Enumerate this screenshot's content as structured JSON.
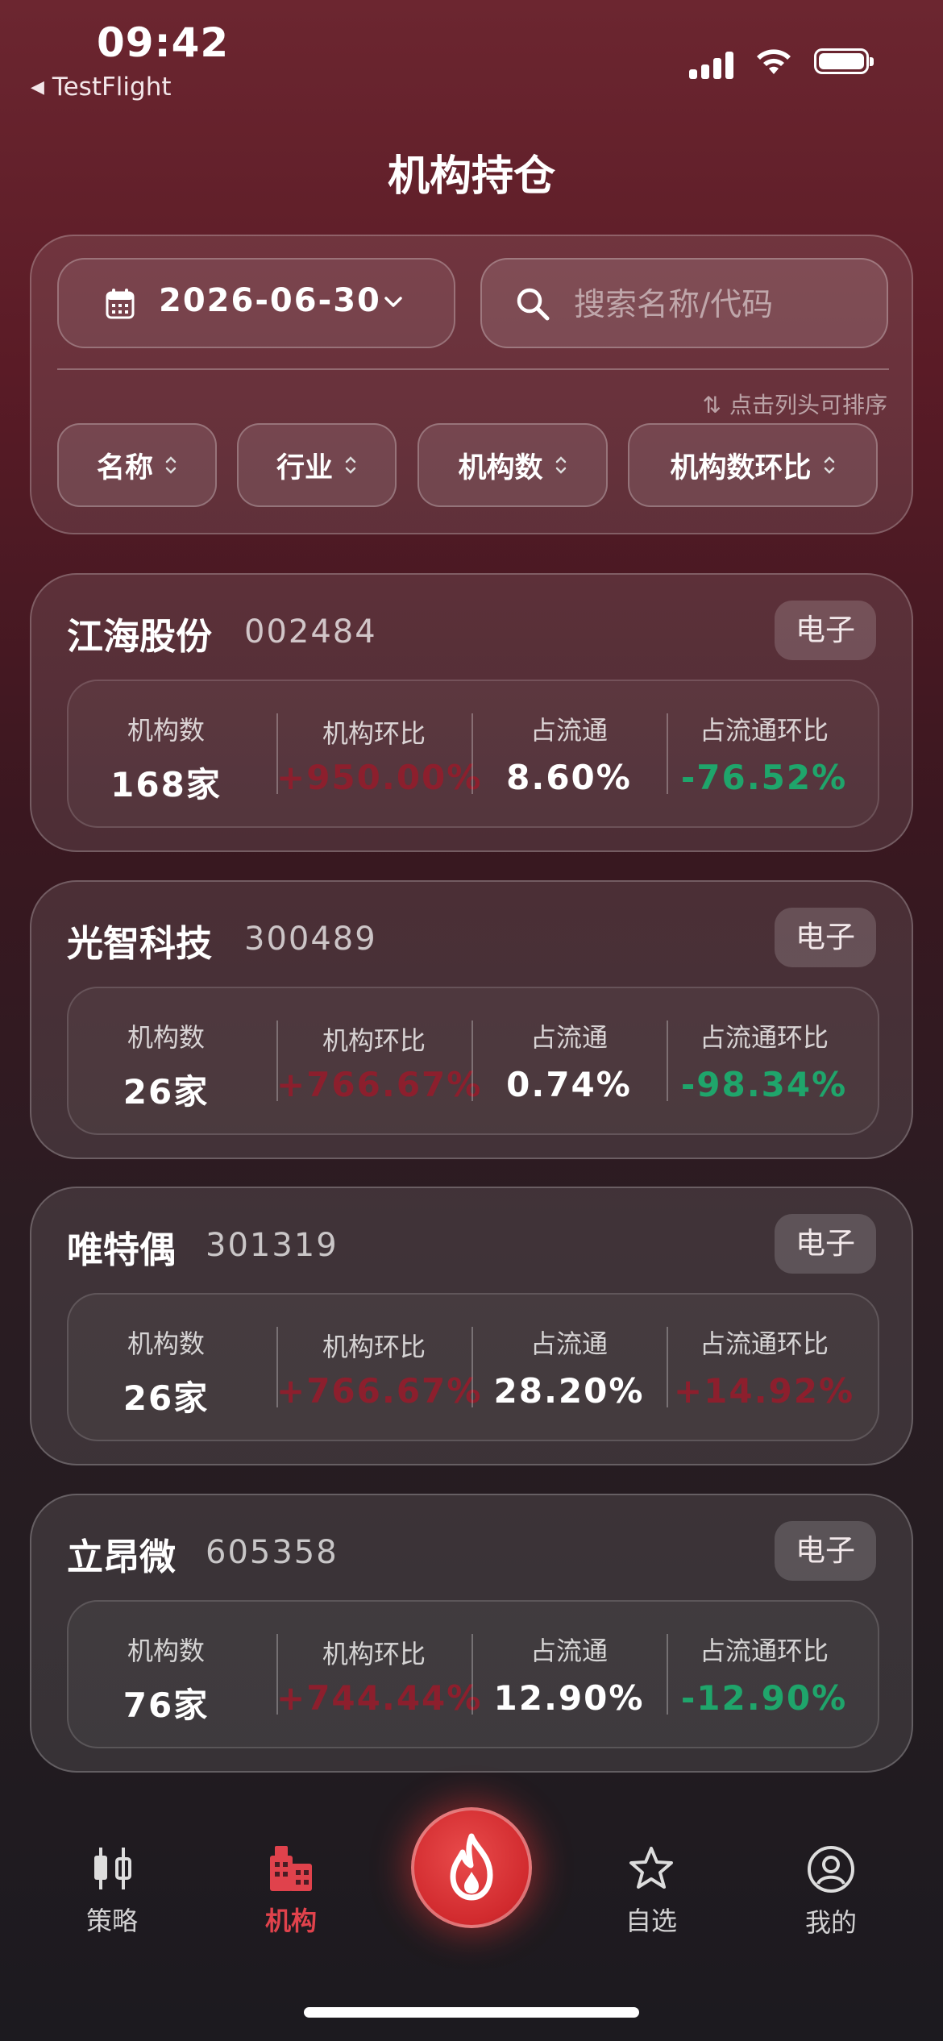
{
  "status_bar": {
    "time": "09:42",
    "back_app": "TestFlight"
  },
  "page": {
    "title": "机构持仓"
  },
  "filters": {
    "date": "2026-06-30",
    "search_placeholder": "搜索名称/代码",
    "sort_hint": "点击列头可排序",
    "sort_columns": [
      "名称",
      "行业",
      "机构数",
      "机构数环比"
    ]
  },
  "stat_labels": {
    "inst_count": "机构数",
    "inst_qoq": "机构环比",
    "float_ratio": "占流通",
    "float_qoq": "占流通环比"
  },
  "stocks": [
    {
      "name": "江海股份",
      "code": "002484",
      "industry": "电子",
      "inst_count": "168家",
      "inst_qoq": "+950.00%",
      "float_ratio": "8.60%",
      "float_qoq": "-76.52%"
    },
    {
      "name": "光智科技",
      "code": "300489",
      "industry": "电子",
      "inst_count": "26家",
      "inst_qoq": "+766.67%",
      "float_ratio": "0.74%",
      "float_qoq": "-98.34%"
    },
    {
      "name": "唯特偶",
      "code": "301319",
      "industry": "电子",
      "inst_count": "26家",
      "inst_qoq": "+766.67%",
      "float_ratio": "28.20%",
      "float_qoq": "+14.92%"
    },
    {
      "name": "立昂微",
      "code": "605358",
      "industry": "电子",
      "inst_count": "76家",
      "inst_qoq": "+744.44%",
      "float_ratio": "12.90%",
      "float_qoq": "-12.90%"
    }
  ],
  "colors": {
    "up": "#8c1f2d",
    "down": "#1fa56b",
    "accent": "#e0424c"
  },
  "tabs": [
    {
      "label": "策略",
      "icon": "candlestick-icon",
      "active": false
    },
    {
      "label": "机构",
      "icon": "building-icon",
      "active": true
    },
    {
      "label": "自选",
      "icon": "star-icon",
      "active": false
    },
    {
      "label": "我的",
      "icon": "user-circle-icon",
      "active": false
    }
  ],
  "center_button": {
    "icon": "flame-icon"
  }
}
